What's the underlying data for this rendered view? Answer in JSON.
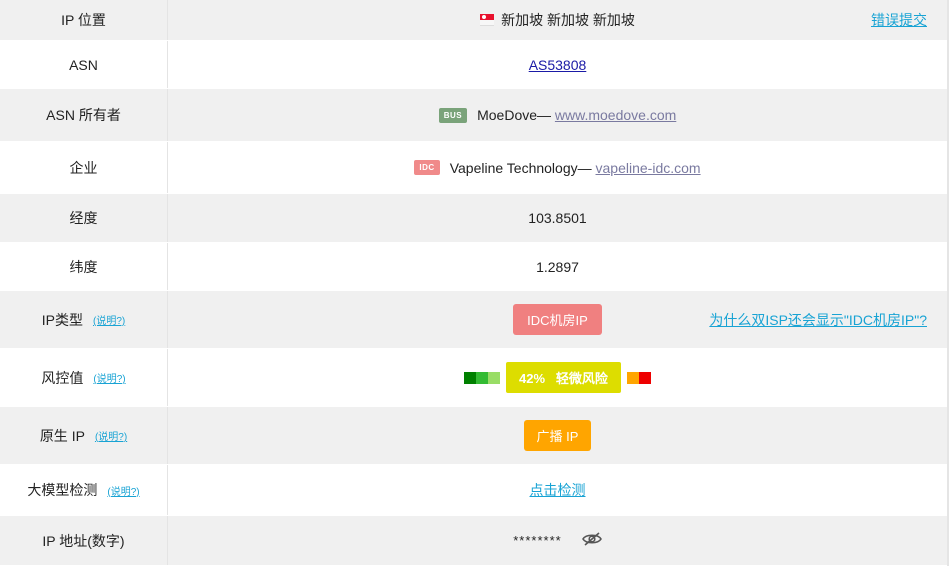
{
  "rows": {
    "location": {
      "label": "IP 位置",
      "value": "新加坡 新加坡 新加坡",
      "action": "错误提交",
      "flag_colors": [
        "#e8112d",
        "#f7f7f7"
      ]
    },
    "asn": {
      "label": "ASN",
      "value": "AS53808"
    },
    "asn_owner": {
      "label": "ASN 所有者",
      "badge": "BUS",
      "badge_color": "#7aa37a",
      "name": "MoeDove",
      "sep": "—",
      "url": "www.moedove.com"
    },
    "company": {
      "label": "企业",
      "badge": "IDC",
      "badge_color": "#f08a8a",
      "name": "Vapeline Technology",
      "sep": "—",
      "url": "vapeline-idc.com"
    },
    "longitude": {
      "label": "经度",
      "value": "103.8501"
    },
    "latitude": {
      "label": "纬度",
      "value": "1.2897"
    },
    "ip_type": {
      "label": "IP类型",
      "help": "(说明?)",
      "value": "IDC机房IP",
      "value_color": "#f08080",
      "action": "为什么双ISP还会显示\"IDC机房IP\"?"
    },
    "risk": {
      "label": "风控值",
      "help": "(说明?)",
      "percent": "42%",
      "level": "轻微风险",
      "pill_color": "#dddd00",
      "scale_colors": [
        "#008000",
        "#33bb33",
        "#99dd66",
        "#dddd00",
        "#ffa500",
        "#ee0000"
      ]
    },
    "native_ip": {
      "label": "原生 IP",
      "help": "(说明?)",
      "value": "广播 IP",
      "value_color": "#ffa500"
    },
    "llm_check": {
      "label": "大模型检测",
      "help": "(说明?)",
      "action": "点击检测"
    },
    "ip_numeric": {
      "label": "IP 地址(数字)",
      "value": "********",
      "toggle_icon": "eye-slash-icon"
    }
  }
}
